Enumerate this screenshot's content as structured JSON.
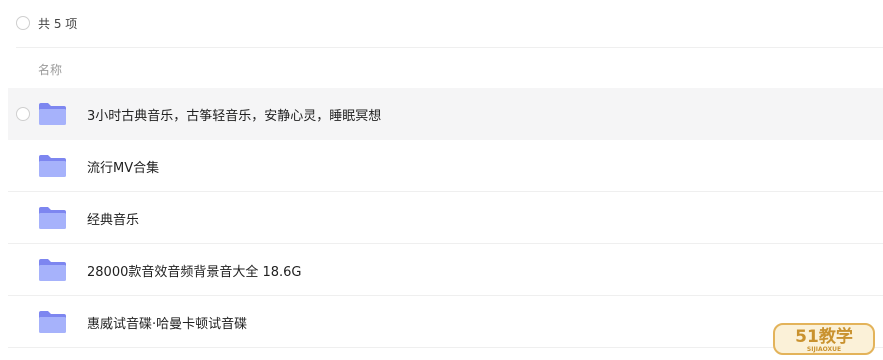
{
  "summary": {
    "count_text": "共 5 项"
  },
  "list_header": {
    "name_column": "名称"
  },
  "files": [
    {
      "name": "3小时古典音乐，古筝轻音乐，安静心灵，睡眠冥想",
      "icon": "folder-icon",
      "hovered": true
    },
    {
      "name": "流行MV合集",
      "icon": "folder-icon",
      "hovered": false
    },
    {
      "name": "经典音乐",
      "icon": "folder-icon",
      "hovered": false
    },
    {
      "name": "28000款音效音频背景音大全 18.6G",
      "icon": "folder-icon",
      "hovered": false
    },
    {
      "name": "惠威试音碟·哈曼卡顿试音碟",
      "icon": "folder-icon",
      "hovered": false
    }
  ],
  "watermark": {
    "main_text": "51教学",
    "sub_text": "SIJIAOXUE"
  },
  "colors": {
    "folder_back": "#7d86f0",
    "folder_front": "#a6b2fb",
    "hover_row": "#f5f5f6",
    "divider": "#efefef",
    "watermark_gold": "#e3b35a"
  }
}
